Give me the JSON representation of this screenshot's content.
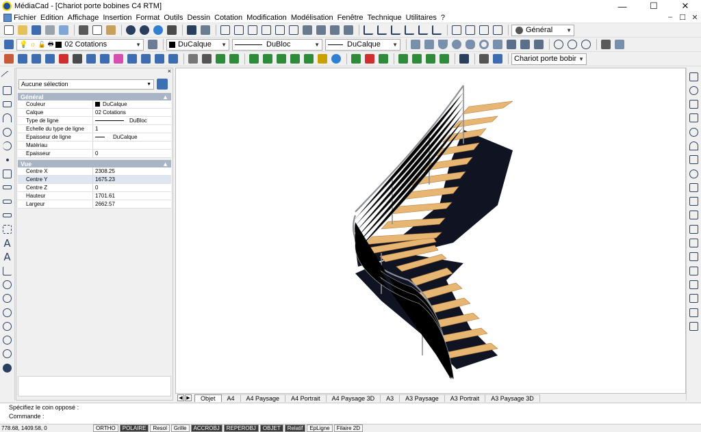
{
  "window": {
    "title": "MédiaCad - [Chariot porte bobines C4 RTM]",
    "minimize": "—",
    "maximize": "☐",
    "close": "✕"
  },
  "menu": {
    "items": [
      "Fichier",
      "Edition",
      "Affichage",
      "Insertion",
      "Format",
      "Outils",
      "Dessin",
      "Cotation",
      "Modification",
      "Modélisation",
      "Fenêtre",
      "Technique",
      "Utilitaires",
      "?"
    ],
    "doc_controls": [
      "–",
      "☐",
      "✕"
    ]
  },
  "toolbar1": {
    "view_combo": "Général"
  },
  "toolbar2": {
    "layer_combo": "02 Cotations",
    "color_combo": "DuCalque",
    "linetype_combo": "DuBloc",
    "lineweight_combo": "DuCalque"
  },
  "toolbar3": {
    "block_combo": "Chariot porte bobines"
  },
  "panel": {
    "close": "×",
    "selection": "Aucune sélection",
    "general": {
      "title": "Général",
      "collapse": "▲",
      "rows": [
        {
          "k": "Couleur",
          "v": "DuCalque"
        },
        {
          "k": "Calque",
          "v": "02 Cotations"
        },
        {
          "k": "Type de ligne",
          "v": "DuBloc"
        },
        {
          "k": "Echelle du type de ligne",
          "v": "1"
        },
        {
          "k": "Epaisseur de ligne",
          "v": "DuCalque"
        },
        {
          "k": "Matériau",
          "v": ""
        },
        {
          "k": "Epaisseur",
          "v": "0"
        }
      ]
    },
    "vue": {
      "title": "Vue",
      "collapse": "▲",
      "rows": [
        {
          "k": "Centre X",
          "v": "2308.25"
        },
        {
          "k": "Centre Y",
          "v": "1675.23"
        },
        {
          "k": "Centre Z",
          "v": "0"
        },
        {
          "k": "Hauteur",
          "v": "1701.61"
        },
        {
          "k": "Largeur",
          "v": "2662.57"
        }
      ]
    }
  },
  "tabs": {
    "nav_prev": "◀",
    "nav_next": "▶",
    "items": [
      "Objet",
      "A4",
      "A4 Paysage",
      "A4 Portrait",
      "A4 Paysage 3D",
      "A3",
      "A3 Paysage",
      "A3 Portrait",
      "A3 Paysage 3D"
    ],
    "active": "Objet"
  },
  "command": {
    "line1": "Spécifiez le coin opposé :",
    "line2": "Commande :"
  },
  "status": {
    "coords": "778.68, 1409.58, 0",
    "buttons": [
      {
        "label": "ORTHO",
        "on": false
      },
      {
        "label": "POLAIRE",
        "on": true
      },
      {
        "label": "Resol",
        "on": false
      },
      {
        "label": "Grille",
        "on": false
      },
      {
        "label": "ACCROBJ",
        "on": true
      },
      {
        "label": "REPEROBJ",
        "on": true
      },
      {
        "label": "OBJET",
        "on": true
      },
      {
        "label": "Relatif",
        "on": true
      },
      {
        "label": "EpLigne",
        "on": false
      },
      {
        "label": "Filaire 2D",
        "on": false
      }
    ]
  },
  "colors": {
    "tread": "#e8b673",
    "tread_edge": "#b07a3a",
    "stringer": "#101322",
    "rail": "#8a8f96",
    "accent": "#2a3f5e"
  }
}
